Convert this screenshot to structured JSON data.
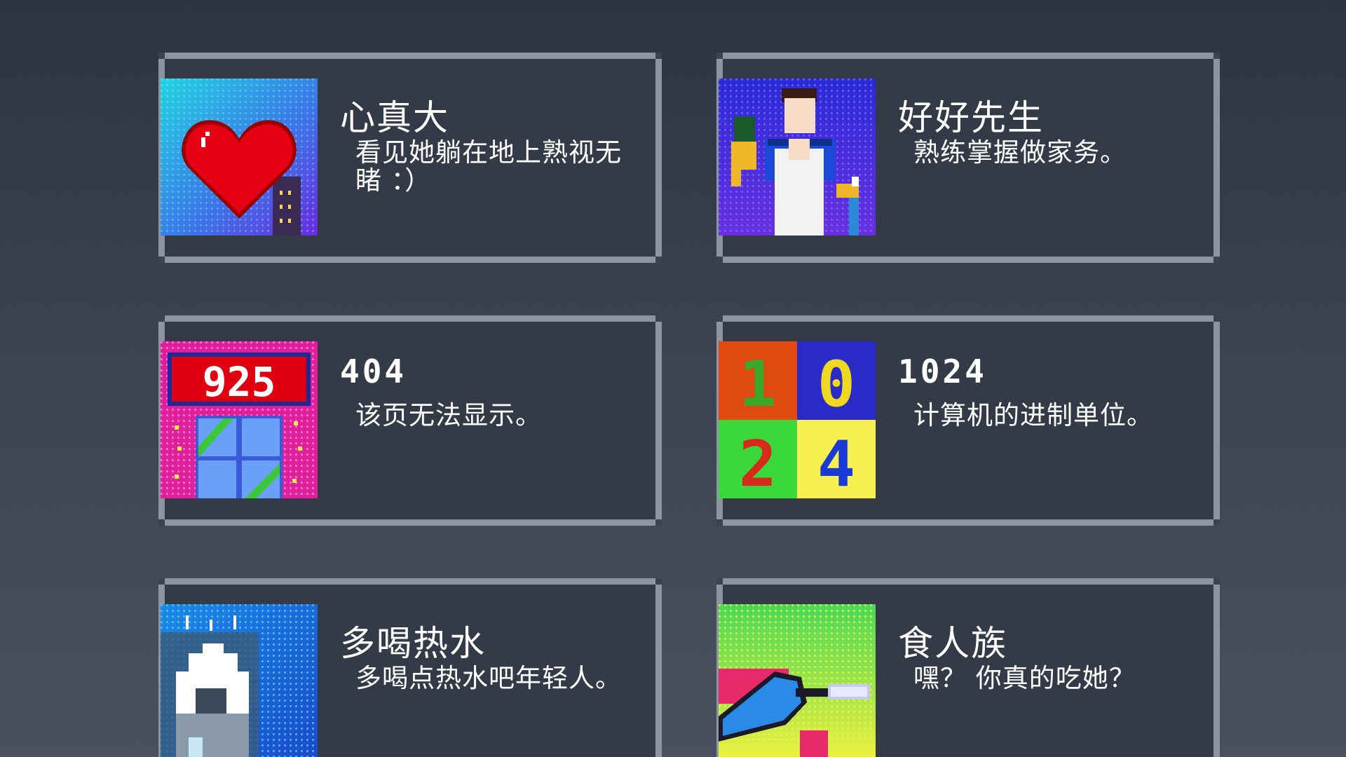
{
  "achievements": [
    {
      "title": "心真大",
      "desc": "看见她躺在地上熟视无睹 ：）",
      "icon": "heart-icon"
    },
    {
      "title": "好好先生",
      "desc": "熟练掌握做家务。",
      "icon": "housekeeper-icon"
    },
    {
      "title": "404",
      "desc": "该页无法显示。",
      "icon": "gift-box-925-icon",
      "icon_text": "925"
    },
    {
      "title": "1024",
      "desc": "计算机的进制单位。",
      "icon": "number-grid-1024-icon",
      "icon_digits": [
        "1",
        "0",
        "2",
        "4"
      ]
    },
    {
      "title": "多喝热水",
      "desc": "多喝点热水吧年轻人。",
      "icon": "hot-water-icon"
    },
    {
      "title": "食人族",
      "desc": "嘿？ 你真的吃她？",
      "icon": "cannibal-icon"
    }
  ],
  "colors": {
    "card_border": "#8c95a1",
    "card_bg": "#343b47",
    "page_bg_top": "#2e3340",
    "page_bg_bottom": "#48515f"
  }
}
